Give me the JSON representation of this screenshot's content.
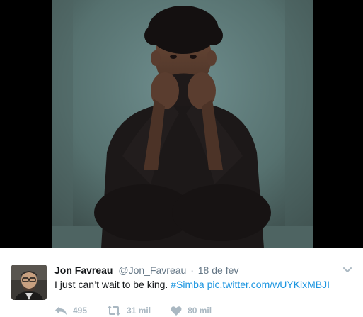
{
  "tweet": {
    "fullname": "Jon Favreau",
    "handle": "@Jon_Favreau",
    "separator": "·",
    "timestamp": "18 de fev",
    "text_plain": "I just can’t wait to be king.",
    "hashtag": "#Simba",
    "media_link": "pic.twitter.com/wUYKixMBJI",
    "actions": {
      "reply_count": "495",
      "retweet_count": "31 mil",
      "like_count": "80 mil"
    }
  },
  "colors": {
    "link": "#1b95e0",
    "text": "#14171a",
    "muted": "#657786",
    "action_icon": "#aab8c2",
    "viewer_background": "#000000"
  },
  "icons": {
    "reply": "reply-icon",
    "retweet": "retweet-icon",
    "like": "heart-icon",
    "menu": "chevron-down-icon"
  }
}
